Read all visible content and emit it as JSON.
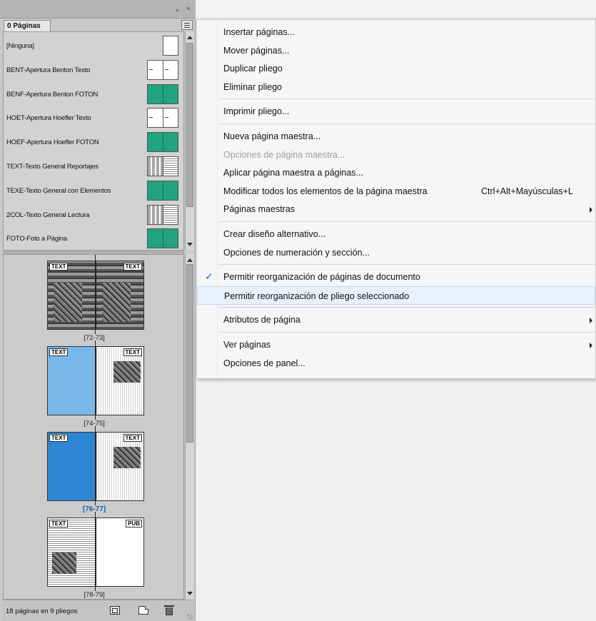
{
  "panel": {
    "tab_label": "0 Páginas",
    "collapse_glyph": "«",
    "close_glyph": "×",
    "masters": [
      {
        "label": "[Ninguna]",
        "thumb": "single"
      },
      {
        "label": "BENT-Apertura Benton Texto",
        "thumb": "white"
      },
      {
        "label": "BENF-Apertura Benton FOTON",
        "thumb": "green"
      },
      {
        "label": "HOET-Apertura Hoefler Texto",
        "thumb": "white"
      },
      {
        "label": "HOEF-Apertura Hoefler FOTON",
        "thumb": "green"
      },
      {
        "label": "TEXT-Texto General Reportajes",
        "thumb": "grid"
      },
      {
        "label": "TEXE-Texto General con Elementos",
        "thumb": "green"
      },
      {
        "label": "2COL-Texto General Lectura",
        "thumb": "grid"
      },
      {
        "label": "FOTO-Foto a Página",
        "thumb": "green"
      }
    ],
    "spreads": [
      {
        "caption": "[72-73]",
        "left_chip": "TEXT",
        "right_chip": "TEXT",
        "left": "photo",
        "right": "photo",
        "selected": false
      },
      {
        "caption": "[74-75]",
        "left_chip": "TEXT",
        "right_chip": "TEXT",
        "left": "lightblue",
        "right": "columns",
        "selected": false
      },
      {
        "caption": "[76-77]",
        "left_chip": "TEXT",
        "right_chip": "TEXT",
        "left": "darkblue",
        "right": "columns",
        "selected": true
      },
      {
        "caption": "[78-79]",
        "left_chip": "TEXT",
        "right_chip": "PUB",
        "left": "colwide",
        "right": "white",
        "selected": false
      }
    ],
    "footer_text": "18 páginas en 9 pliegos"
  },
  "menu": {
    "groups": [
      [
        {
          "label": "Insertar páginas..."
        },
        {
          "label": "Mover páginas..."
        },
        {
          "label": "Duplicar pliego"
        },
        {
          "label": "Eliminar pliego"
        }
      ],
      [
        {
          "label": "Imprimir pliego..."
        }
      ],
      [
        {
          "label": "Nueva página maestra..."
        },
        {
          "label": "Opciones de página maestra...",
          "disabled": true
        },
        {
          "label": "Aplicar página maestra a páginas..."
        },
        {
          "label": "Modificar todos los elementos de la página maestra",
          "shortcut": "Ctrl+Alt+Mayúsculas+L"
        },
        {
          "label": "Páginas maestras",
          "submenu": true
        }
      ],
      [
        {
          "label": "Crear diseño alternativo..."
        },
        {
          "label": "Opciones de numeración y sección..."
        }
      ],
      [
        {
          "label": "Permitir reorganización de páginas de documento",
          "checked": true
        },
        {
          "label": "Permitir reorganización de pliego seleccionado",
          "highlighted": true
        }
      ],
      [
        {
          "label": "Atributos de página",
          "submenu": true
        }
      ],
      [
        {
          "label": "Ver páginas",
          "submenu": true
        },
        {
          "label": "Opciones de panel..."
        }
      ]
    ]
  },
  "colors": {
    "check": "#1d62c7",
    "master_green": "#1fa47b",
    "selected_caption": "#1b5fb0"
  }
}
